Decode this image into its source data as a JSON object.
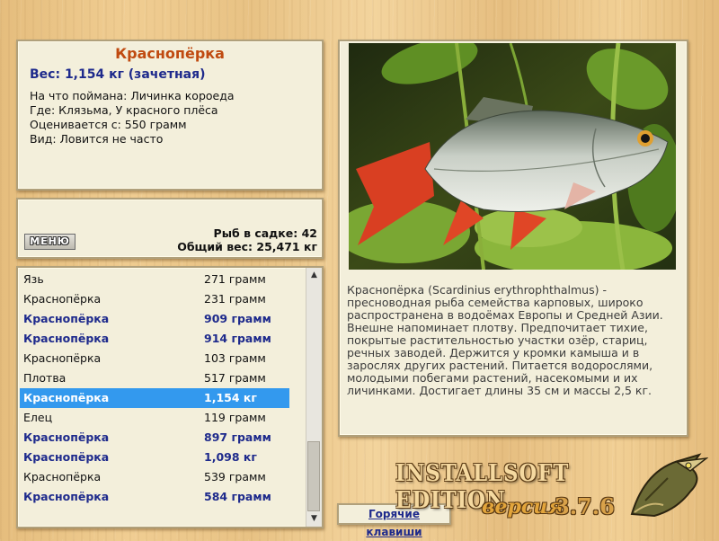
{
  "info": {
    "title": "Краснопёрка",
    "weight": "Вес: 1,154 кг (зачетная)",
    "details": [
      "На что поймана: Личинка короеда",
      "Где: Клязьма, У красного плёса",
      "Оценивается с: 550 грамм",
      "Вид: Ловится не часто"
    ]
  },
  "stats": {
    "menu_label": "МЕНЮ",
    "fish_in_net": "Рыб в садке: 42",
    "total_weight": "Общий вес: 25,471 кг"
  },
  "catch_list": [
    {
      "name": "Язь",
      "weight": "271 грамм",
      "style": "normal"
    },
    {
      "name": "Краснопёрка",
      "weight": "231 грамм",
      "style": "normal"
    },
    {
      "name": "Краснопёрка",
      "weight": "909 грамм",
      "style": "bold"
    },
    {
      "name": "Краснопёрка",
      "weight": "914 грамм",
      "style": "bold"
    },
    {
      "name": "Краснопёрка",
      "weight": "103 грамм",
      "style": "normal"
    },
    {
      "name": "Плотва",
      "weight": "517 грамм",
      "style": "normal"
    },
    {
      "name": "Краснопёрка",
      "weight": "1,154 кг",
      "style": "selected"
    },
    {
      "name": "Елец",
      "weight": "119 грамм",
      "style": "normal"
    },
    {
      "name": "Краснопёрка",
      "weight": "897 грамм",
      "style": "bold"
    },
    {
      "name": "Краснопёрка",
      "weight": "1,098 кг",
      "style": "bold"
    },
    {
      "name": "Краснопёрка",
      "weight": "539 грамм",
      "style": "normal"
    },
    {
      "name": "Краснопёрка",
      "weight": "584 грамм",
      "style": "bold"
    }
  ],
  "detail": {
    "description": "Краснопёрка (Scardinius erythrophthalmus) - пресноводная рыба семейства карповых, широко распространена в водоёмах Европы и Средней Азии. Внешне напоминает плотву. Предпочитает тихие, покрытые растительностью участки озёр, стариц, речных заводей. Держится у кромки камыша и в зарослях других растений. Питается водорослями, молодыми побегами растений, насекомыми и их личинками. Достигает длины 35 см и массы 2,5 кг."
  },
  "footer": {
    "hotkeys_label": "Горячие клавиши",
    "edition": "INSTALLSOFT EDITION",
    "version_word": "версия",
    "version_number": "3.7.6"
  },
  "colors": {
    "title": "#c04a10",
    "highlight_text": "#1e2a8c",
    "selection": "#3399ee",
    "panel": "#f3efdb"
  }
}
